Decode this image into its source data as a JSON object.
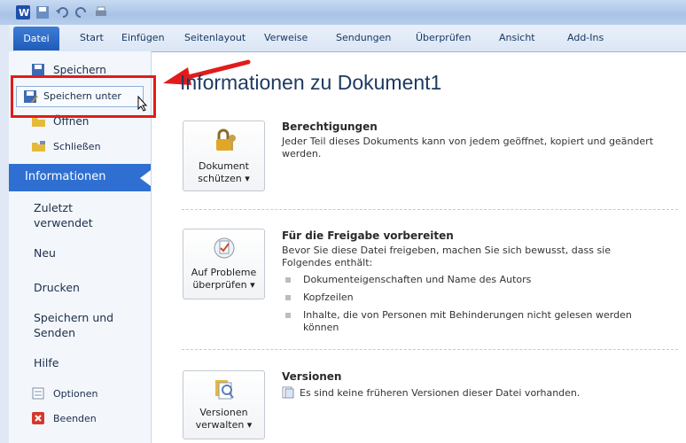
{
  "tabs": [
    "Datei",
    "Start",
    "Einfügen",
    "Seitenlayout",
    "Verweise",
    "Sendungen",
    "Überprüfen",
    "Ansicht",
    "Add-Ins"
  ],
  "sidebar": {
    "save": "Speichern",
    "save_as": "Speichern unter",
    "open": "Öffnen",
    "close": "Schließen",
    "info": "Informationen",
    "recent_line1": "Zuletzt",
    "recent_line2": "verwendet",
    "new": "Neu",
    "print": "Drucken",
    "save_send_line1": "Speichern und",
    "save_send_line2": "Senden",
    "help": "Hilfe",
    "options": "Optionen",
    "exit": "Beenden"
  },
  "main": {
    "title": "Informationen zu Dokument1",
    "permissions": {
      "button_line1": "Dokument",
      "button_line2": "schützen ▾",
      "title": "Berechtigungen",
      "text": "Jeder Teil dieses Dokuments kann von jedem geöffnet, kopiert und geändert werden."
    },
    "sharing": {
      "button_line1": "Auf Probleme",
      "button_line2": "überprüfen ▾",
      "title": "Für die Freigabe vorbereiten",
      "text": "Bevor Sie diese Datei freigeben, machen Sie sich bewusst, dass sie Folgendes enthält:",
      "bullets": [
        "Dokumenteigenschaften und Name des Autors",
        "Kopfzeilen",
        "Inhalte, die von Personen mit Behinderungen nicht gelesen werden können"
      ]
    },
    "versions": {
      "button_line1": "Versionen",
      "button_line2": "verwalten ▾",
      "title": "Versionen",
      "text": "Es sind keine früheren Versionen dieser Datei vorhanden."
    }
  },
  "colors": {
    "accent": "#2f6fd2",
    "highlight": "#e21b1b"
  }
}
